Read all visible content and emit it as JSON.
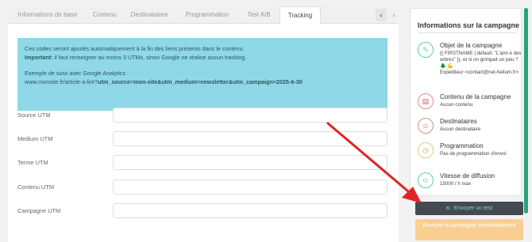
{
  "tabs": [
    {
      "label": "Informations de base",
      "active": false
    },
    {
      "label": "Contenu",
      "active": false
    },
    {
      "label": "Destinataires",
      "active": false
    },
    {
      "label": "Programmation",
      "active": false
    },
    {
      "label": "Test A/B",
      "active": false
    },
    {
      "label": "Tracking",
      "active": true
    }
  ],
  "tab_nav": {
    "left": "‹",
    "right": "›"
  },
  "info_box": {
    "line1": "Ces codes seront ajoutés automatiquement à la fin des liens présents dans le contenu.",
    "important_label": "Important:",
    "important_text": " il faut renseigner au moins 3 UTMs, sinon Google ne réalise aucun tracking.",
    "example_label": "Exemple de suivi avec Google Analytics :",
    "example_url_base": "www.monsite.fr/article-a-lire?",
    "example_url_params": "utm_source=mon-site&utm_medium=newsletter&utm_campaign=2025-6-30"
  },
  "fields": [
    {
      "label": "Source UTM",
      "value": ""
    },
    {
      "label": "Medium UTM",
      "value": ""
    },
    {
      "label": "Terme UTM",
      "value": ""
    },
    {
      "label": "Contenu UTM",
      "value": ""
    },
    {
      "label": "Campagne UTM",
      "value": ""
    }
  ],
  "sidebar": {
    "title": "Informations sur la campagne",
    "steps": [
      {
        "icon": "pencil-icon",
        "title": "Objet de la campagne",
        "desc": "{{ FIRSTNAME | default: \"L'ami·e des arbres\" }}, et si on grimpait un peu ? 🌲 💪",
        "desc2": "Expéditeur <contact@net-helium.fr>",
        "status": "green"
      },
      {
        "icon": "document-icon",
        "title": "Contenu de la campagne",
        "desc": "Aucun contenu",
        "desc2": "",
        "status": "red"
      },
      {
        "icon": "users-icon",
        "title": "Destinataires",
        "desc": "Aucun destinataire",
        "desc2": "",
        "status": "red"
      },
      {
        "icon": "clock-icon",
        "title": "Programmation",
        "desc": "Pas de programmation d'envoi",
        "desc2": "",
        "status": "orange"
      },
      {
        "icon": "send-icon",
        "title": "Vitesse de diffusion",
        "desc": "15000 / h max",
        "desc2": "",
        "status": "green"
      }
    ]
  },
  "buttons": {
    "test": "Envoyer un test",
    "send": "Envoyer la campagne immédiatement"
  },
  "colors": {
    "accent": "#28a37c",
    "info_bg": "#8ed8e8",
    "send_btn": "#f9cf91",
    "test_btn": "#444a4f",
    "arrow": "#e02424"
  }
}
